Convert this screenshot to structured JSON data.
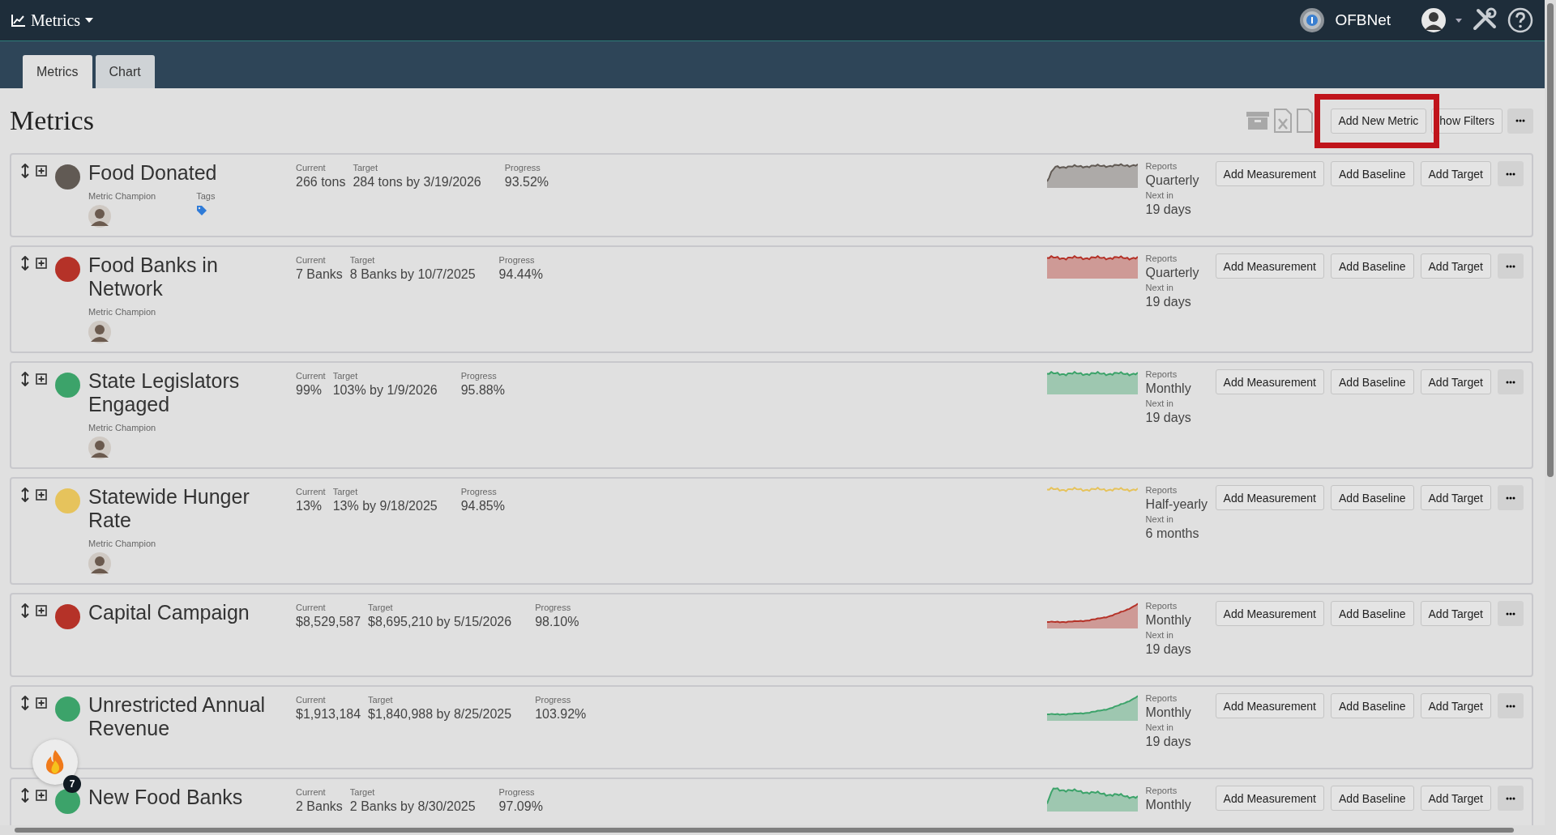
{
  "header": {
    "app_title": "Metrics",
    "org_name": "OFBNet"
  },
  "tabs": [
    {
      "label": "Metrics",
      "selected": true
    },
    {
      "label": "Chart",
      "selected": false
    }
  ],
  "page": {
    "title": "Metrics",
    "add_button": "Add New Metric",
    "add_button_highlighted": true,
    "filters_button": "how Filters"
  },
  "metrics": [
    {
      "name": "Food Donated",
      "color": "#615a54",
      "current_label": "Current",
      "current": "266 tons",
      "target_label": "Target",
      "target": "284 tons by 3/19/2026",
      "progress_label": "Progress",
      "progress": "93.52%",
      "champion_label": "Metric Champion",
      "tags_label": "Tags",
      "filled": true,
      "reports_label": "Reports",
      "frequency": "Quarterly",
      "next_label": "Next in",
      "next_in": "19 days",
      "actions": [
        "Add Measurement",
        "Add Baseline",
        "Add Target"
      ]
    },
    {
      "name": "Food Banks in Network",
      "color": "#b53228",
      "current_label": "Current",
      "current": "7 Banks",
      "target_label": "Target",
      "target": "8 Banks by 10/7/2025",
      "progress_label": "Progress",
      "progress": "94.44%",
      "champion_label": "Metric Champion",
      "filled": true,
      "reports_label": "Reports",
      "frequency": "Quarterly",
      "next_label": "Next in",
      "next_in": "19 days",
      "actions": [
        "Add Measurement",
        "Add Baseline",
        "Add Target"
      ]
    },
    {
      "name": "State Legislators Engaged",
      "color": "#3ca36a",
      "current_label": "Current",
      "current": "99%",
      "target_label": "Target",
      "target": "103% by 1/9/2026",
      "progress_label": "Progress",
      "progress": "95.88%",
      "champion_label": "Metric Champion",
      "filled": true,
      "reports_label": "Reports",
      "frequency": "Monthly",
      "next_label": "Next in",
      "next_in": "19 days",
      "actions": [
        "Add Measurement",
        "Add Baseline",
        "Add Target"
      ]
    },
    {
      "name": "Statewide Hunger Rate",
      "color": "#e6c35c",
      "current_label": "Current",
      "current": "13%",
      "target_label": "Target",
      "target": "13% by 9/18/2025",
      "progress_label": "Progress",
      "progress": "94.85%",
      "champion_label": "Metric Champion",
      "filled": false,
      "reports_label": "Reports",
      "frequency": "Half-yearly",
      "next_label": "Next in",
      "next_in": "6 months",
      "actions": [
        "Add Measurement",
        "Add Baseline",
        "Add Target"
      ]
    },
    {
      "name": "Capital Campaign",
      "color": "#b53228",
      "current_label": "Current",
      "current": "$8,529,587",
      "target_label": "Target",
      "target": "$8,695,210 by 5/15/2026",
      "progress_label": "Progress",
      "progress": "98.10%",
      "filled": true,
      "reports_label": "Reports",
      "frequency": "Monthly",
      "next_label": "Next in",
      "next_in": "19 days",
      "actions": [
        "Add Measurement",
        "Add Baseline",
        "Add Target"
      ]
    },
    {
      "name": "Unrestricted Annual Revenue",
      "color": "#3ca36a",
      "current_label": "Current",
      "current": "$1,913,184",
      "target_label": "Target",
      "target": "$1,840,988 by 8/25/2025",
      "progress_label": "Progress",
      "progress": "103.92%",
      "filled": true,
      "reports_label": "Reports",
      "frequency": "Monthly",
      "next_label": "Next in",
      "next_in": "19 days",
      "actions": [
        "Add Measurement",
        "Add Baseline",
        "Add Target"
      ]
    },
    {
      "name": "New Food Banks",
      "color": "#3ca36a",
      "current_label": "Current",
      "current": "2 Banks",
      "target_label": "Target",
      "target": "2 Banks by 8/30/2025",
      "progress_label": "Progress",
      "progress": "97.09%",
      "filled": true,
      "reports_label": "Reports",
      "frequency": "Monthly",
      "actions": [
        "Add Measurement",
        "Add Baseline",
        "Add Target"
      ]
    }
  ],
  "notification": {
    "count": "7"
  }
}
